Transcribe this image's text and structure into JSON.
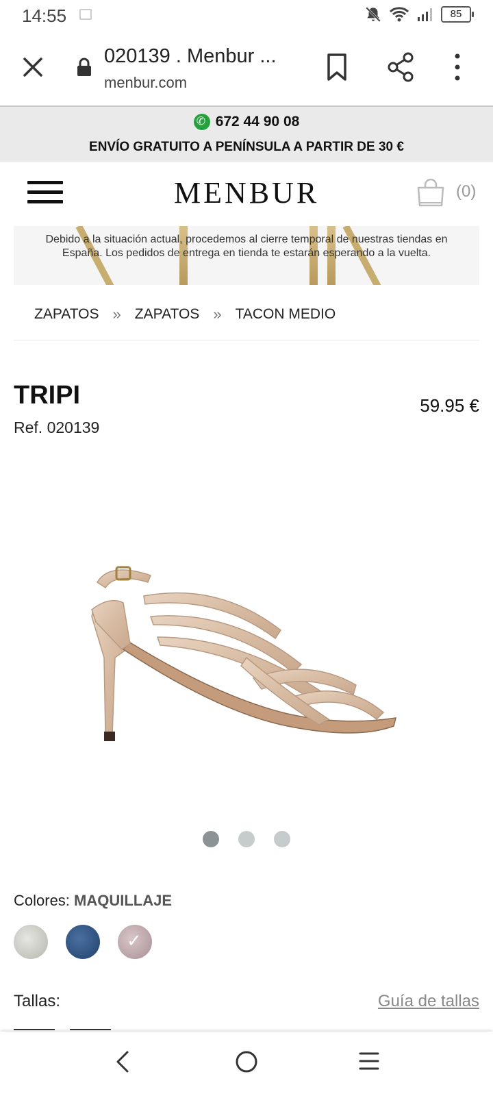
{
  "status_bar": {
    "time": "14:55",
    "battery": "85"
  },
  "browser": {
    "title": "020139 . Menbur ...",
    "domain": "menbur.com"
  },
  "info_banner": {
    "phone": "672 44 90 08",
    "shipping": "ENVÍO GRATUITO A PENÍNSULA A PARTIR DE 30 €"
  },
  "site_header": {
    "logo": "MENBUR",
    "cart_count": "(0)"
  },
  "notice": {
    "text": "Debido a la situación actual, procedemos al cierre temporal de nuestras tiendas en España. Los pedidos de entrega en tienda te estarán esperando a la vuelta."
  },
  "breadcrumb": {
    "items": [
      "ZAPATOS",
      "ZAPATOS",
      "TACON MEDIO"
    ],
    "separator": "»"
  },
  "product": {
    "name": "TRIPI",
    "ref": "Ref. 020139",
    "price": "59.95 €"
  },
  "carousel": {
    "count": 3,
    "active_index": 0
  },
  "colors": {
    "label": "Colores:",
    "selected": "MAQUILLAJE",
    "swatches": [
      "silver",
      "navy",
      "makeup"
    ],
    "selected_swatch": "makeup"
  },
  "sizes": {
    "label": "Tallas:",
    "guide_link": "Guía de tallas"
  },
  "colors_palette": {
    "accent_whatsapp": "#25a23e",
    "banner_gray": "#eaeaea"
  }
}
